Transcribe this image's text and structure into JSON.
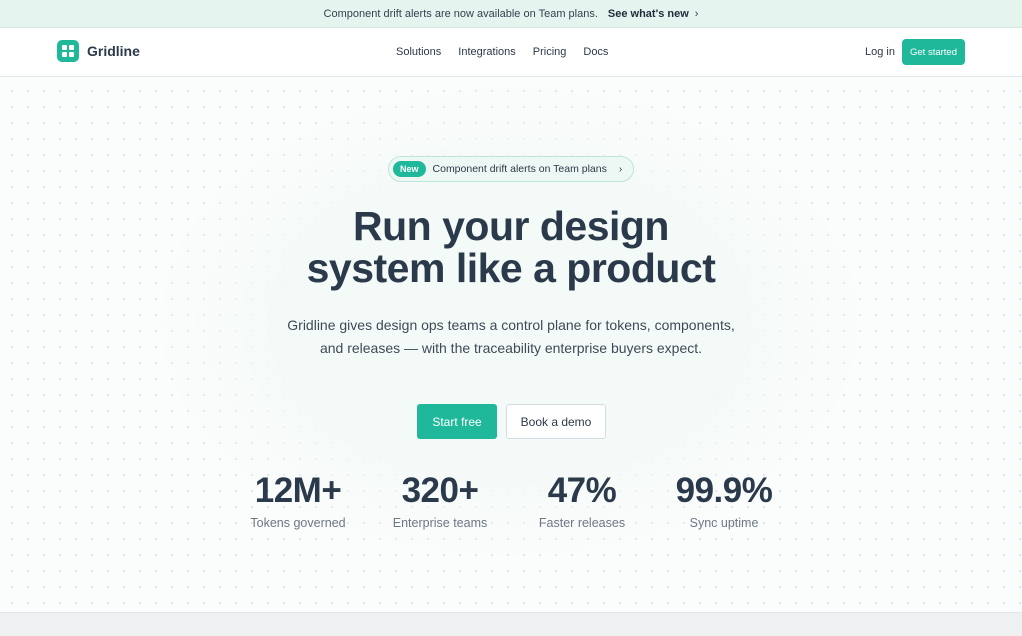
{
  "announcement": {
    "text": "Component drift alerts are now available on Team plans.",
    "link_label": "See what's new",
    "chevron": "›"
  },
  "nav": {
    "brand": "Gridline",
    "logo_icon": "grid-icon",
    "menu": [
      {
        "label": "Solutions"
      },
      {
        "label": "Integrations"
      },
      {
        "label": "Pricing"
      },
      {
        "label": "Docs"
      }
    ],
    "login_label": "Log in",
    "cta_label": "Get started"
  },
  "hero": {
    "pill": {
      "tag": "New",
      "text": "Component drift alerts on Team plans",
      "chevron": "›"
    },
    "headline_line1": "Run your design",
    "headline_line2": "system like a product",
    "subheadline": "Gridline gives design ops teams a control plane for tokens, components, and releases — with the traceability enterprise buyers expect.",
    "primary_button": "Start free",
    "secondary_button": "Book a demo",
    "stats": [
      {
        "value": "12M+",
        "label": "Tokens governed"
      },
      {
        "value": "320+",
        "label": "Enterprise teams"
      },
      {
        "value": "47%",
        "label": "Faster releases"
      },
      {
        "value": "99.9%",
        "label": "Sync uptime"
      }
    ]
  },
  "colors": {
    "accent": "#1fb89a",
    "text": "#2b3a4b",
    "muted": "#6d7884",
    "announcement_bg": "#e6f4f0"
  }
}
